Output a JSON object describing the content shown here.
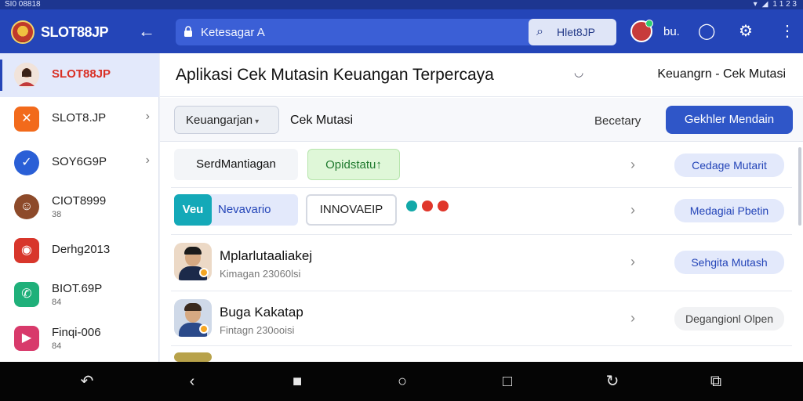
{
  "status_bar": {
    "left": "SI0 08818",
    "right": "1 1 2 3"
  },
  "app_bar": {
    "logo": "SLOT88JP",
    "url": "Ketesagar A",
    "search_value": "Hlet8JP",
    "lang": "bu."
  },
  "sidebar": {
    "items": [
      {
        "label": "SLOT88JP",
        "sub": "",
        "color": "#e8e8e8",
        "icon": "avatar"
      },
      {
        "label": "SLOT8.JP",
        "sub": "",
        "color": "#f26a1b",
        "icon": "x-icon"
      },
      {
        "label": "SOY6G9P",
        "sub": "",
        "color": "#2a5fd6",
        "icon": "check-icon"
      },
      {
        "label": "CIOT8999",
        "sub": "38",
        "color": "#8d4a2a",
        "icon": "person-icon"
      },
      {
        "label": "Derhg2013",
        "sub": "",
        "color": "#d8362b",
        "icon": "camera-icon"
      },
      {
        "label": "BIOT.69P",
        "sub": "84",
        "color": "#1fb07a",
        "icon": "phone-icon"
      },
      {
        "label": "Finqi-006",
        "sub": "84",
        "color": "#d83a6b",
        "icon": "youtube-icon"
      }
    ]
  },
  "main": {
    "title": "Aplikasi Cek Mutasin Keuangan Terpercaya",
    "title_right": "Keuangrn - Cek Mutasi",
    "toolbar": {
      "dropdown": "Keuangarjan",
      "label": "Cek Mutasi",
      "right_label": "Becetary",
      "primary": "Gekhler Mendain"
    },
    "rows": [
      {
        "chip1": "SerdMantiagan",
        "chip2": "Opidstatu",
        "action": "Cedage Mutarit"
      },
      {
        "chip_accent": "Veu",
        "chip1": "Nevavario",
        "chip2": "INNOVAEIP",
        "action": "Medagiai Pbetin"
      },
      {
        "name": "Mplarlutaaliakej",
        "sub": "Kimagan 23060lsi",
        "action": "Sehgita Mutash"
      },
      {
        "name": "Buga Kakatap",
        "sub": "Fintagn 230ooisi",
        "action": "Degangionl Olpen"
      }
    ]
  },
  "colors": {
    "primary": "#2445b8",
    "accent": "#2f56c8",
    "green_chip": "#dff7d8"
  }
}
